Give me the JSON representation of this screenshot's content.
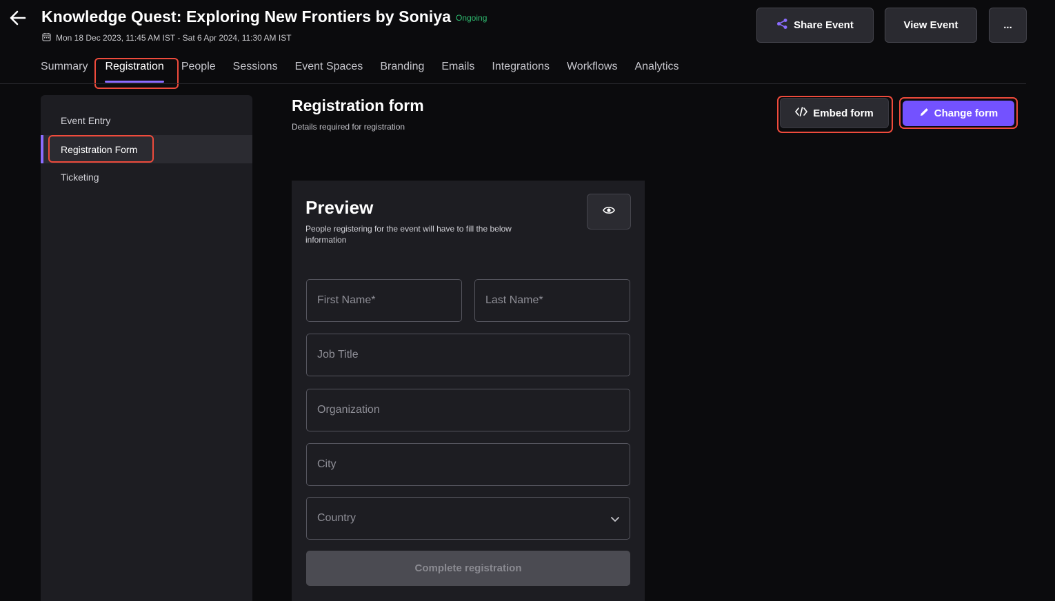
{
  "header": {
    "title": "Knowledge Quest: Exploring New Frontiers by Soniya",
    "status": "Ongoing",
    "date_range": "Mon 18 Dec 2023, 11:45 AM IST - Sat 6 Apr 2024, 11:30 AM IST",
    "share_label": "Share Event",
    "view_label": "View Event",
    "more_label": "...",
    "status_color": "#2fbf71"
  },
  "tabs": [
    {
      "label": "Summary"
    },
    {
      "label": "Registration",
      "active": true
    },
    {
      "label": "People"
    },
    {
      "label": "Sessions"
    },
    {
      "label": "Event Spaces"
    },
    {
      "label": "Branding"
    },
    {
      "label": "Emails"
    },
    {
      "label": "Integrations"
    },
    {
      "label": "Workflows"
    },
    {
      "label": "Analytics"
    }
  ],
  "sidebar": {
    "items": [
      {
        "label": "Event Entry"
      },
      {
        "label": "Registration Form",
        "active": true
      },
      {
        "label": "Ticketing"
      }
    ]
  },
  "main": {
    "title": "Registration form",
    "subtitle": "Details required for registration",
    "embed_label": "Embed form",
    "change_label": "Change form",
    "accent_color": "#7352ff"
  },
  "preview": {
    "title": "Preview",
    "description": "People registering for the event will have to fill the below information",
    "fields": {
      "first_name": "First Name*",
      "last_name": "Last Name*",
      "job_title": "Job Title",
      "organization": "Organization",
      "city": "City",
      "country": "Country"
    },
    "submit_label": "Complete registration"
  },
  "icons": [
    "arrow-left-icon",
    "calendar-icon",
    "share-icon",
    "code-icon",
    "pencil-icon",
    "eye-icon",
    "chevron-down-icon"
  ],
  "highlight_color": "#ef4b3c"
}
